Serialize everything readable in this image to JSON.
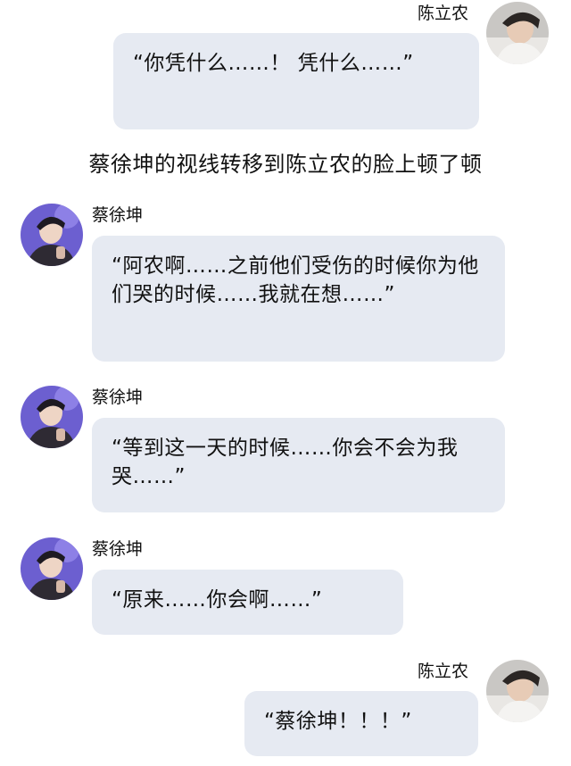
{
  "messages": [
    {
      "speaker": "陈立农",
      "side": "right",
      "avatar_icon": "user-avatar-icon",
      "text": "“你凭什么……！ 凭什么……”"
    },
    {
      "narration": "蔡徐坤的视线转移到陈立农的脸上顿了顿"
    },
    {
      "speaker": "蔡徐坤",
      "side": "left",
      "avatar_icon": "user-avatar-icon",
      "text": "“阿农啊……之前他们受伤的时候你为他们哭的时候……我就在想……”"
    },
    {
      "speaker": "蔡徐坤",
      "side": "left",
      "avatar_icon": "user-avatar-icon",
      "text": "“等到这一天的时候……你会不会为我哭……”"
    },
    {
      "speaker": "蔡徐坤",
      "side": "left",
      "avatar_icon": "user-avatar-icon",
      "text": "“原来……你会啊……”"
    },
    {
      "speaker": "陈立农",
      "side": "right",
      "avatar_icon": "user-avatar-icon",
      "text": "“蔡徐坤！！！”"
    }
  ],
  "colors": {
    "bubble": "#e6eaf2",
    "text": "#111111",
    "background": "#ffffff"
  }
}
